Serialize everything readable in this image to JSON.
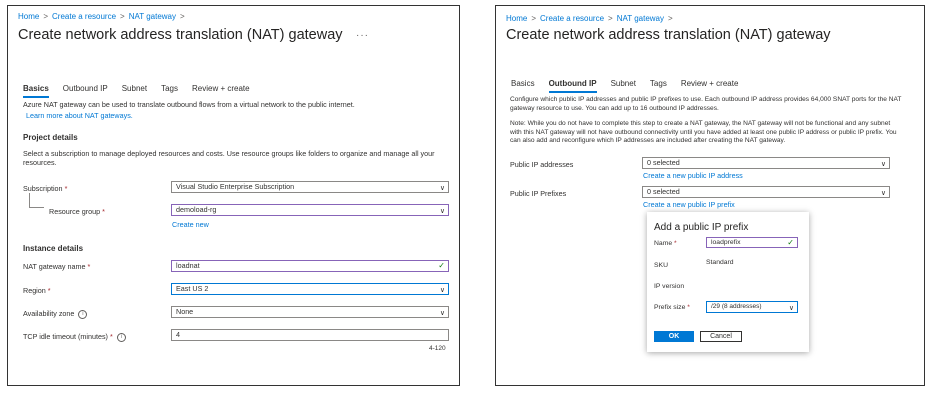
{
  "left": {
    "breadcrumb": [
      "Home",
      "Create a resource",
      "NAT gateway"
    ],
    "title": "Create network address translation (NAT) gateway",
    "more": "···",
    "tabs": [
      "Basics",
      "Outbound IP",
      "Subnet",
      "Tags",
      "Review + create"
    ],
    "active_tab": "Basics",
    "intro": "Azure NAT gateway can be used to translate outbound flows from a virtual network to the public internet.",
    "learn_more": "Learn more about NAT gateways.",
    "project_heading": "Project details",
    "project_text": "Select a subscription to manage deployed resources and costs. Use resource groups like folders to organize and manage all your resources.",
    "subscription_label": "Subscription",
    "subscription_value": "Visual Studio Enterprise Subscription",
    "rg_label": "Resource group",
    "rg_value": "demoload-rg",
    "create_new": "Create new",
    "instance_heading": "Instance details",
    "name_label": "NAT gateway name",
    "name_value": "loadnat",
    "region_label": "Region",
    "region_value": "East US 2",
    "az_label": "Availability zone",
    "az_value": "None",
    "timeout_label": "TCP idle timeout (minutes)",
    "timeout_value": "4",
    "timeout_range": "4-120"
  },
  "right": {
    "breadcrumb": [
      "Home",
      "Create a resource",
      "NAT gateway"
    ],
    "title": "Create network address translation (NAT) gateway",
    "more": "···",
    "tabs": [
      "Basics",
      "Outbound IP",
      "Subnet",
      "Tags",
      "Review + create"
    ],
    "active_tab": "Outbound IP",
    "intro": "Configure which public IP addresses and public IP prefixes to use. Each outbound IP address provides 64,000 SNAT ports for the NAT gateway resource to use. You can add up to 16 outbound IP addresses.",
    "note": "Note: While you do not have to complete this step to create a NAT gateway, the NAT gateway will not be functional and any subnet with this NAT gateway will not have outbound connectivity until you have added at least one public IP address or public IP prefix. You can also add and reconfigure which IP addresses are included after creating the NAT gateway.",
    "pip_label": "Public IP addresses",
    "pip_value": "0 selected",
    "pip_link": "Create a new public IP address",
    "prefix_label": "Public IP Prefixes",
    "prefix_value": "0 selected",
    "prefix_link": "Create a new public IP prefix"
  },
  "dialog": {
    "title": "Add a public IP prefix",
    "name_label": "Name",
    "name_value": "loadprefix",
    "sku_label": "SKU",
    "sku_value": "Standard",
    "ipversion_label": "IP version",
    "prefix_size_label": "Prefix size",
    "prefix_size_value": "/29 (8 addresses)",
    "ok": "OK",
    "cancel": "Cancel"
  },
  "icons": {
    "required": "*",
    "chevron": "chevron-down-icon",
    "check": "checkmark-icon",
    "info": "info-icon"
  },
  "colors": {
    "accent": "#0078d4",
    "required": "#a4262c",
    "valid": "#107c10",
    "focus_border": "#8764b8"
  }
}
